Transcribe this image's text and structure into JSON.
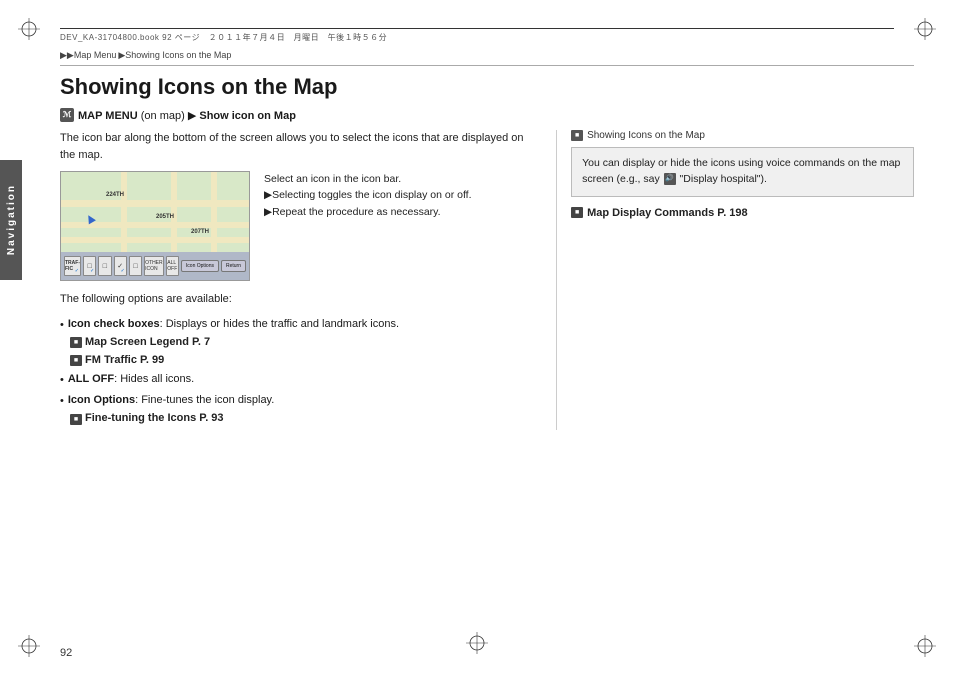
{
  "page": {
    "number": "92",
    "file_info": "DEV_KA-31704800.book  92 ページ　２０１１年７月４日　月曜日　午後１時５６分"
  },
  "breadcrumb": {
    "items": [
      "▶▶Map Menu",
      "▶Showing Icons on the Map"
    ]
  },
  "title": "Showing Icons on the Map",
  "menu_path": {
    "icon_label": "ℳ",
    "prefix": "MAP MENU",
    "suffix": "(on map)",
    "arrow": "▶",
    "action": "Show icon on Map"
  },
  "body_text": "The icon bar along the bottom of the screen allows you to select the icons that are displayed on the map.",
  "map_instructions": {
    "intro": "Select an icon in the icon bar.",
    "step1": "▶Selecting toggles the icon display on or off.",
    "step2": "▶Repeat the procedure as necessary."
  },
  "map_labels": [
    "224TH",
    "205TH",
    "207TH"
  ],
  "map_icon_bar_buttons": [
    "Icon Options",
    "Return"
  ],
  "options_title": "The following options are available:",
  "options": [
    {
      "label": "Icon check boxes",
      "desc": ": Displays or hides the traffic and landmark icons.",
      "refs": [
        {
          "icon": "■",
          "text": "Map Screen Legend P. 7"
        },
        {
          "icon": "■",
          "text": "FM Traffic P. 99"
        }
      ]
    },
    {
      "label": "ALL OFF",
      "desc": ": Hides all icons.",
      "refs": []
    },
    {
      "label": "Icon Options",
      "desc": ": Fine-tunes the icon display.",
      "refs": [
        {
          "icon": "■",
          "text": "Fine-tuning the Icons P. 93"
        }
      ]
    }
  ],
  "right_column": {
    "header": "Showing Icons on the Map",
    "box_text": "You can display or hide the icons using voice commands on the map screen (e.g., say ",
    "box_example": "\"Display hospital\").",
    "link_icon": "■",
    "link_text": "Map Display Commands P. 198"
  },
  "nav_tab": {
    "label": "Navigation"
  }
}
